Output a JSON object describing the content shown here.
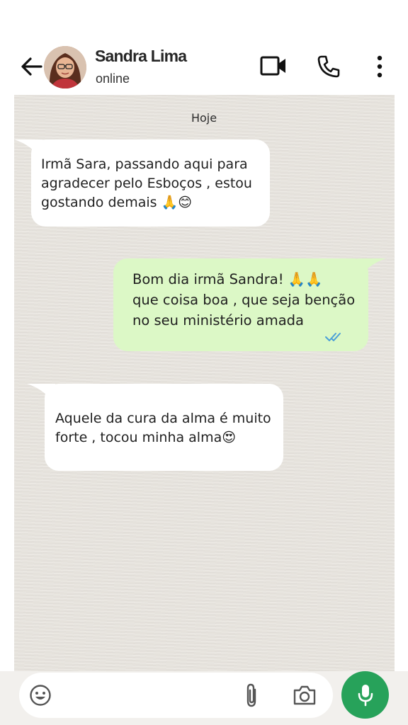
{
  "contact": {
    "name": "Sandra Lima",
    "status": "online"
  },
  "chat": {
    "date": "Hoje",
    "messages": [
      {
        "direction": "incoming",
        "lines": [
          "Irmã Sara,  passando aqui para",
          "agradecer pelo Esboços  , estou",
          "gostando demais 🙏😊"
        ]
      },
      {
        "direction": "outgoing",
        "lines": [
          "Bom dia irmã Sandra! 🙏🙏",
          "que coisa boa , que seja benção",
          "no seu ministério amada"
        ],
        "read": true
      },
      {
        "direction": "incoming",
        "lines": [
          "Aquele da cura da alma é muito",
          "forte , tocou minha alma😍"
        ]
      }
    ]
  },
  "icons": {
    "back": "arrow-left-icon",
    "video": "video-call-icon",
    "call": "phone-icon",
    "menu": "more-vertical-icon",
    "emoji": "emoji-icon",
    "attach": "paperclip-icon",
    "camera": "camera-icon",
    "mic": "microphone-icon"
  },
  "colors": {
    "chat_background": "#e8e4de",
    "outgoing_bubble": "#dcf8c6",
    "incoming_bubble": "#ffffff",
    "mic_button": "#27a25a",
    "read_ticks": "#4a9fd8"
  }
}
